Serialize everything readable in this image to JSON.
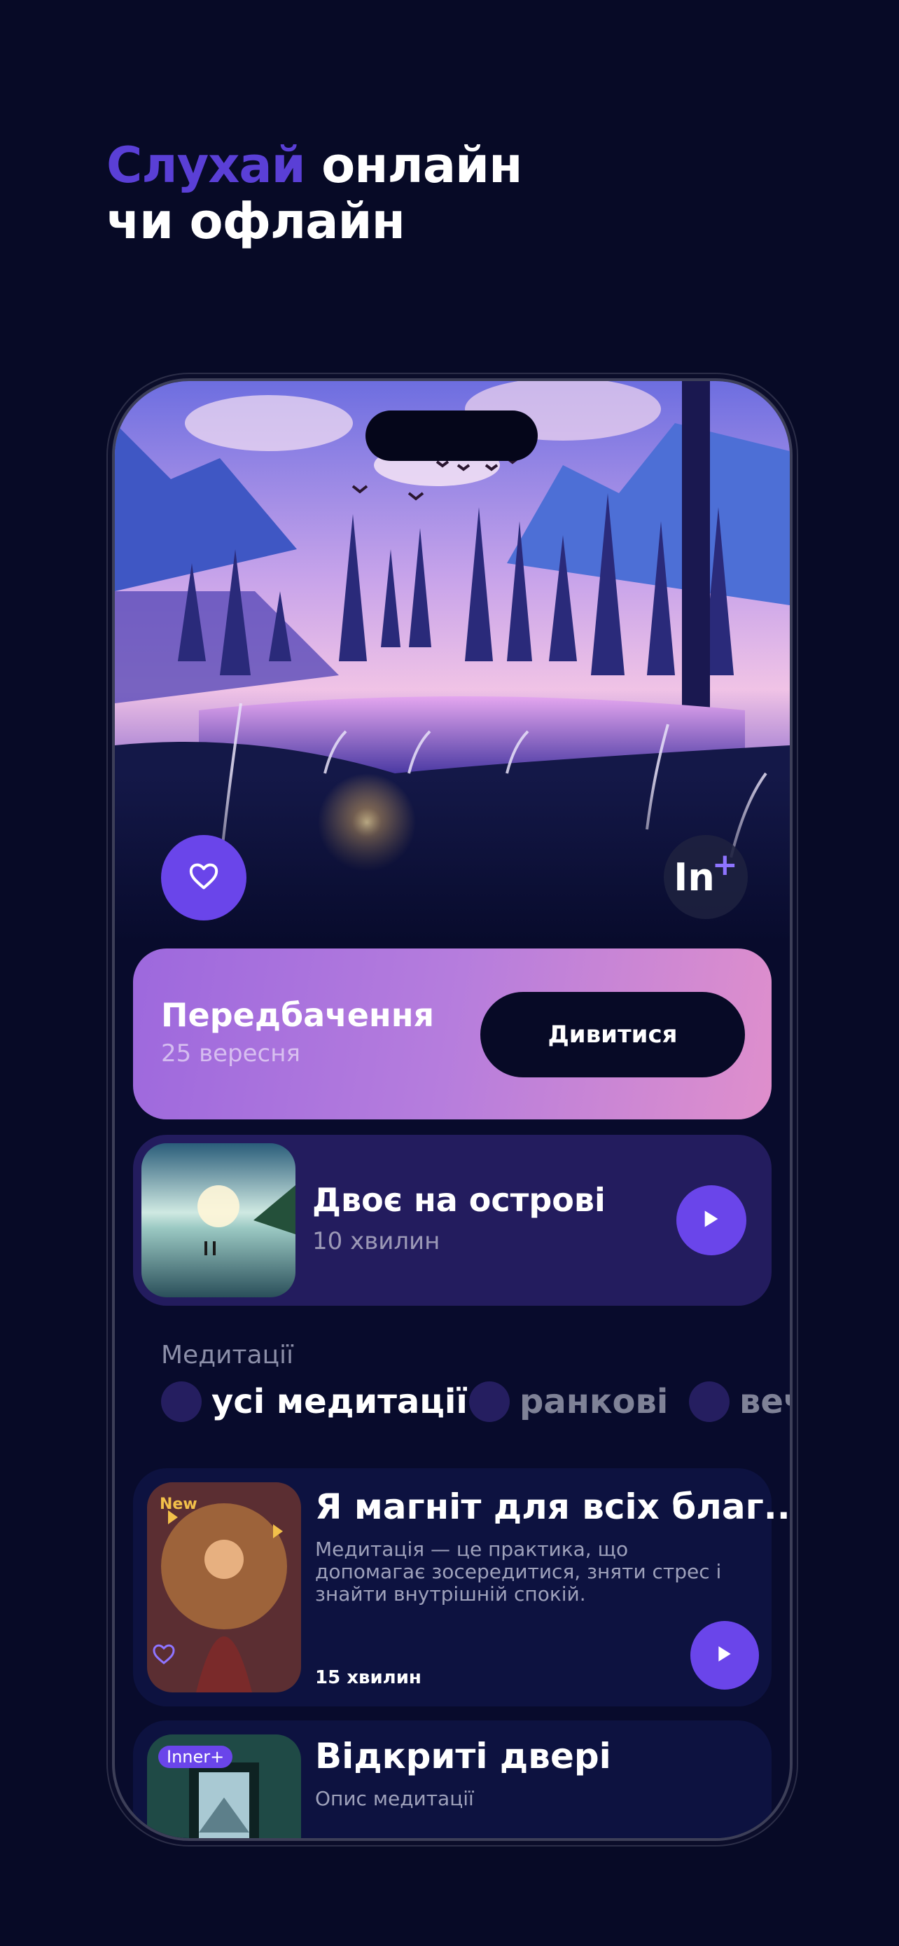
{
  "headline": {
    "accent": "Слухай",
    "line1_rest": " онлайн",
    "line2": "чи офлайн"
  },
  "hero": {
    "brand_label": "In",
    "brand_plus": "+"
  },
  "promo": {
    "title": "Передбачення",
    "date": "25 вересня",
    "button": "Дивитися"
  },
  "now_playing": {
    "title": "Двоє на острові",
    "duration": "10 хвилин"
  },
  "meditations": {
    "section_label": "Медитації",
    "chips": [
      {
        "label": "усі медитації",
        "active": true
      },
      {
        "label": "ранкові",
        "active": false
      },
      {
        "label": "вечірні",
        "active": false
      }
    ],
    "items": [
      {
        "title": "Я магніт для всіх благ...",
        "description": "Медитація — це практика, що допомагає зосередитися, зняти стрес і знайти внутрішній спокій.",
        "duration": "15 хвилин",
        "badge": "New"
      },
      {
        "title": "Відкриті двері",
        "description": "Опис медитації",
        "badge": "Inner+"
      }
    ]
  },
  "colors": {
    "background": "#070a26",
    "accent": "#6a45ea",
    "headline_accent": "#5a3fd6",
    "card": "#231c5e"
  }
}
